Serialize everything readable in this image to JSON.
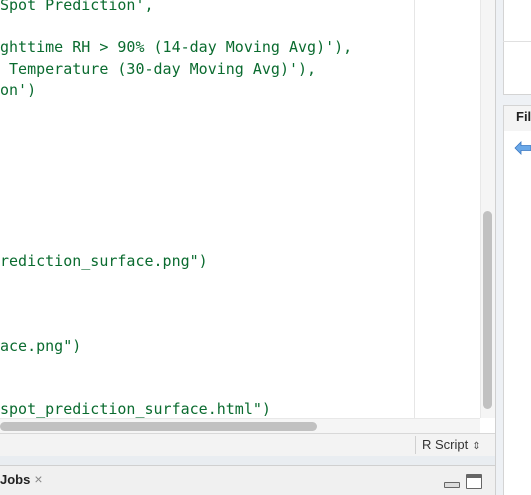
{
  "editor": {
    "code_lines": [
      "Spot Prediction',",
      "ghttime RH > 90% (14-day Moving Avg)'),",
      " Temperature (30-day Moving Avg)'),",
      "on')",
      "rediction_surface.png\")",
      "ace.png\")",
      "spot_prediction_surface.html\")"
    ]
  },
  "status_bar": {
    "file_type": "R Script",
    "file_type_arrows": "⇕"
  },
  "bottom_pane": {
    "tab_label": "Jobs",
    "tab_close": "×"
  },
  "right_pane": {
    "files_tab_label": "Fil"
  },
  "icons": {
    "back": "back-arrow-icon",
    "minimize": "minimize-icon",
    "maximize": "maximize-icon"
  },
  "colors": {
    "string_green": "#0a6b2f",
    "accent_blue": "#4a90d9"
  }
}
